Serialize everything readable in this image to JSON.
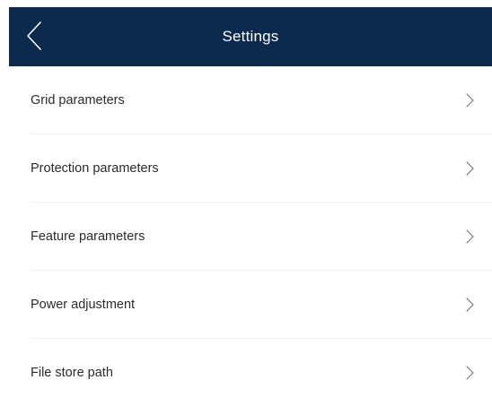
{
  "header": {
    "title": "Settings",
    "back_icon": "chevron-left-icon",
    "background_color": "#0c2a4e",
    "title_color": "#ffffff"
  },
  "settings": {
    "items": [
      {
        "label": "Grid parameters",
        "icon": "chevron-right-icon"
      },
      {
        "label": "Protection parameters",
        "icon": "chevron-right-icon"
      },
      {
        "label": "Feature parameters",
        "icon": "chevron-right-icon"
      },
      {
        "label": "Power adjustment",
        "icon": "chevron-right-icon"
      },
      {
        "label": "File store path",
        "icon": "chevron-right-icon"
      }
    ]
  }
}
